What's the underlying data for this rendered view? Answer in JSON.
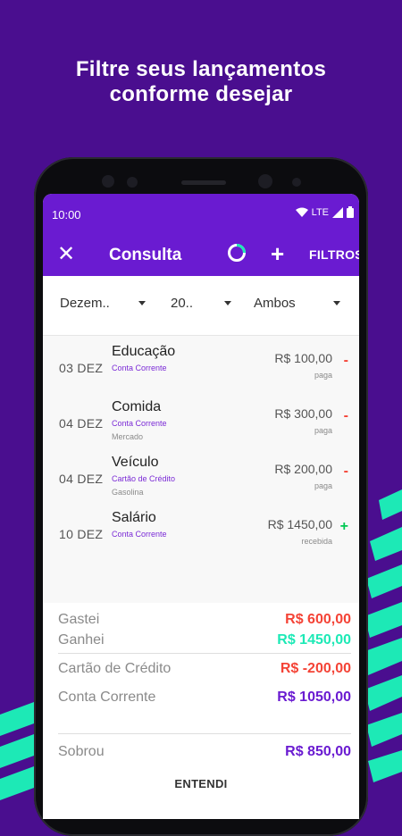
{
  "headline": {
    "line1": "Filtre seus lançamentos",
    "line2": "conforme desejar"
  },
  "status": {
    "time": "10:00",
    "network": "LTE"
  },
  "appbar": {
    "title": "Consulta",
    "filters_label": "FILTROS"
  },
  "filters": {
    "month": "Dezem..",
    "year": "20..",
    "type": "Ambos"
  },
  "entries": [
    {
      "date": "03 DEZ",
      "name": "Educação",
      "account": "Conta Corrente",
      "sub": "",
      "amount": "R$ 100,00",
      "status": "paga",
      "sign": "-"
    },
    {
      "date": "04 DEZ",
      "name": "Comida",
      "account": "Conta Corrente",
      "sub": "Mercado",
      "amount": "R$ 300,00",
      "status": "paga",
      "sign": "-"
    },
    {
      "date": "04 DEZ",
      "name": "Veículo",
      "account": "Cartão de Crédito",
      "sub": "Gasolina",
      "amount": "R$ 200,00",
      "status": "paga",
      "sign": "-"
    },
    {
      "date": "10 DEZ",
      "name": "Salário",
      "account": "Conta Corrente",
      "sub": "",
      "amount": "R$ 1450,00",
      "status": "recebida",
      "sign": "+"
    }
  ],
  "summary": {
    "gastei_label": "Gastei",
    "gastei_value": "R$ 600,00",
    "ganhei_label": "Ganhei",
    "ganhei_value": "R$ 1450,00",
    "cartao_label": "Cartão de Crédito",
    "cartao_value": "R$ -200,00",
    "conta_label": "Conta Corrente",
    "conta_value": "R$ 1050,00",
    "sobrou_label": "Sobrou",
    "sobrou_value": "R$ 850,00",
    "button": "ENTENDI"
  },
  "colors": {
    "background": "#4a0e8f",
    "appbar": "#6a1bd1",
    "accent_green": "#1de9b6",
    "negative": "#f44336",
    "positive": "#00c853",
    "account_purple": "#7b2bd6"
  }
}
